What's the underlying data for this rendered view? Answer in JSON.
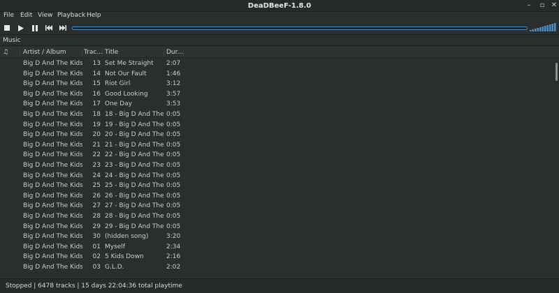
{
  "window": {
    "title": "DeaDBeeF-1.8.0"
  },
  "menu": [
    "File",
    "Edit",
    "View",
    "Playback",
    "Help"
  ],
  "toolbar": {
    "buttons": [
      "stop-icon",
      "play-icon",
      "pause-icon",
      "previous-icon",
      "next-icon"
    ],
    "accent": "#4a90c6"
  },
  "tab": {
    "label": "Music"
  },
  "columns": {
    "playing": "♫",
    "artist_album": "Artist / Album",
    "track": "Trac...",
    "title": "Title",
    "duration": "Dur..."
  },
  "rows": [
    {
      "artist": "Big D And The Kids ...",
      "track": "13",
      "title": "Set Me Straight",
      "duration": "2:07"
    },
    {
      "artist": "Big D And The Kids ...",
      "track": "14",
      "title": "Not Our Fault",
      "duration": "1:46"
    },
    {
      "artist": "Big D And The Kids ...",
      "track": "15",
      "title": "Riot Girl",
      "duration": "3:12"
    },
    {
      "artist": "Big D And The Kids ...",
      "track": "16",
      "title": "Good Looking",
      "duration": "3:57"
    },
    {
      "artist": "Big D And The Kids ...",
      "track": "17",
      "title": "One Day",
      "duration": "3:53"
    },
    {
      "artist": "Big D And The Kids ...",
      "track": "18",
      "title": "18 - Big D And The ...",
      "duration": "0:05"
    },
    {
      "artist": "Big D And The Kids ...",
      "track": "19",
      "title": "19 - Big D And The ...",
      "duration": "0:05"
    },
    {
      "artist": "Big D And The Kids ...",
      "track": "20",
      "title": "20 - Big D And The ...",
      "duration": "0:05"
    },
    {
      "artist": "Big D And The Kids ...",
      "track": "21",
      "title": "21 - Big D And The ...",
      "duration": "0:05"
    },
    {
      "artist": "Big D And The Kids ...",
      "track": "22",
      "title": "22 - Big D And The ...",
      "duration": "0:05"
    },
    {
      "artist": "Big D And The Kids ...",
      "track": "23",
      "title": "23 - Big D And The ...",
      "duration": "0:05"
    },
    {
      "artist": "Big D And The Kids ...",
      "track": "24",
      "title": "24 - Big D And The ...",
      "duration": "0:05"
    },
    {
      "artist": "Big D And The Kids ...",
      "track": "25",
      "title": "25 - Big D And The ...",
      "duration": "0:05"
    },
    {
      "artist": "Big D And The Kids ...",
      "track": "26",
      "title": "26 - Big D And The ...",
      "duration": "0:05"
    },
    {
      "artist": "Big D And The Kids ...",
      "track": "27",
      "title": "27 - Big D And The ...",
      "duration": "0:05"
    },
    {
      "artist": "Big D And The Kids ...",
      "track": "28",
      "title": "28 - Big D And The ...",
      "duration": "0:05"
    },
    {
      "artist": "Big D And The Kids ...",
      "track": "29",
      "title": "29 - Big D And The ...",
      "duration": "0:05"
    },
    {
      "artist": "Big D And The Kids ...",
      "track": "30",
      "title": "(hidden song)",
      "duration": "3:20"
    },
    {
      "artist": "Big D And The Kids ...",
      "track": "01",
      "title": "Myself",
      "duration": "2:34"
    },
    {
      "artist": "Big D And The Kids ...",
      "track": "02",
      "title": "5 Kids Down",
      "duration": "2:16"
    },
    {
      "artist": "Big D And The Kids ...",
      "track": "03",
      "title": "G.L.D.",
      "duration": "2:02"
    }
  ],
  "status": {
    "text": "Stopped | 6478 tracks | 15 days 22:04:36 total playtime"
  }
}
